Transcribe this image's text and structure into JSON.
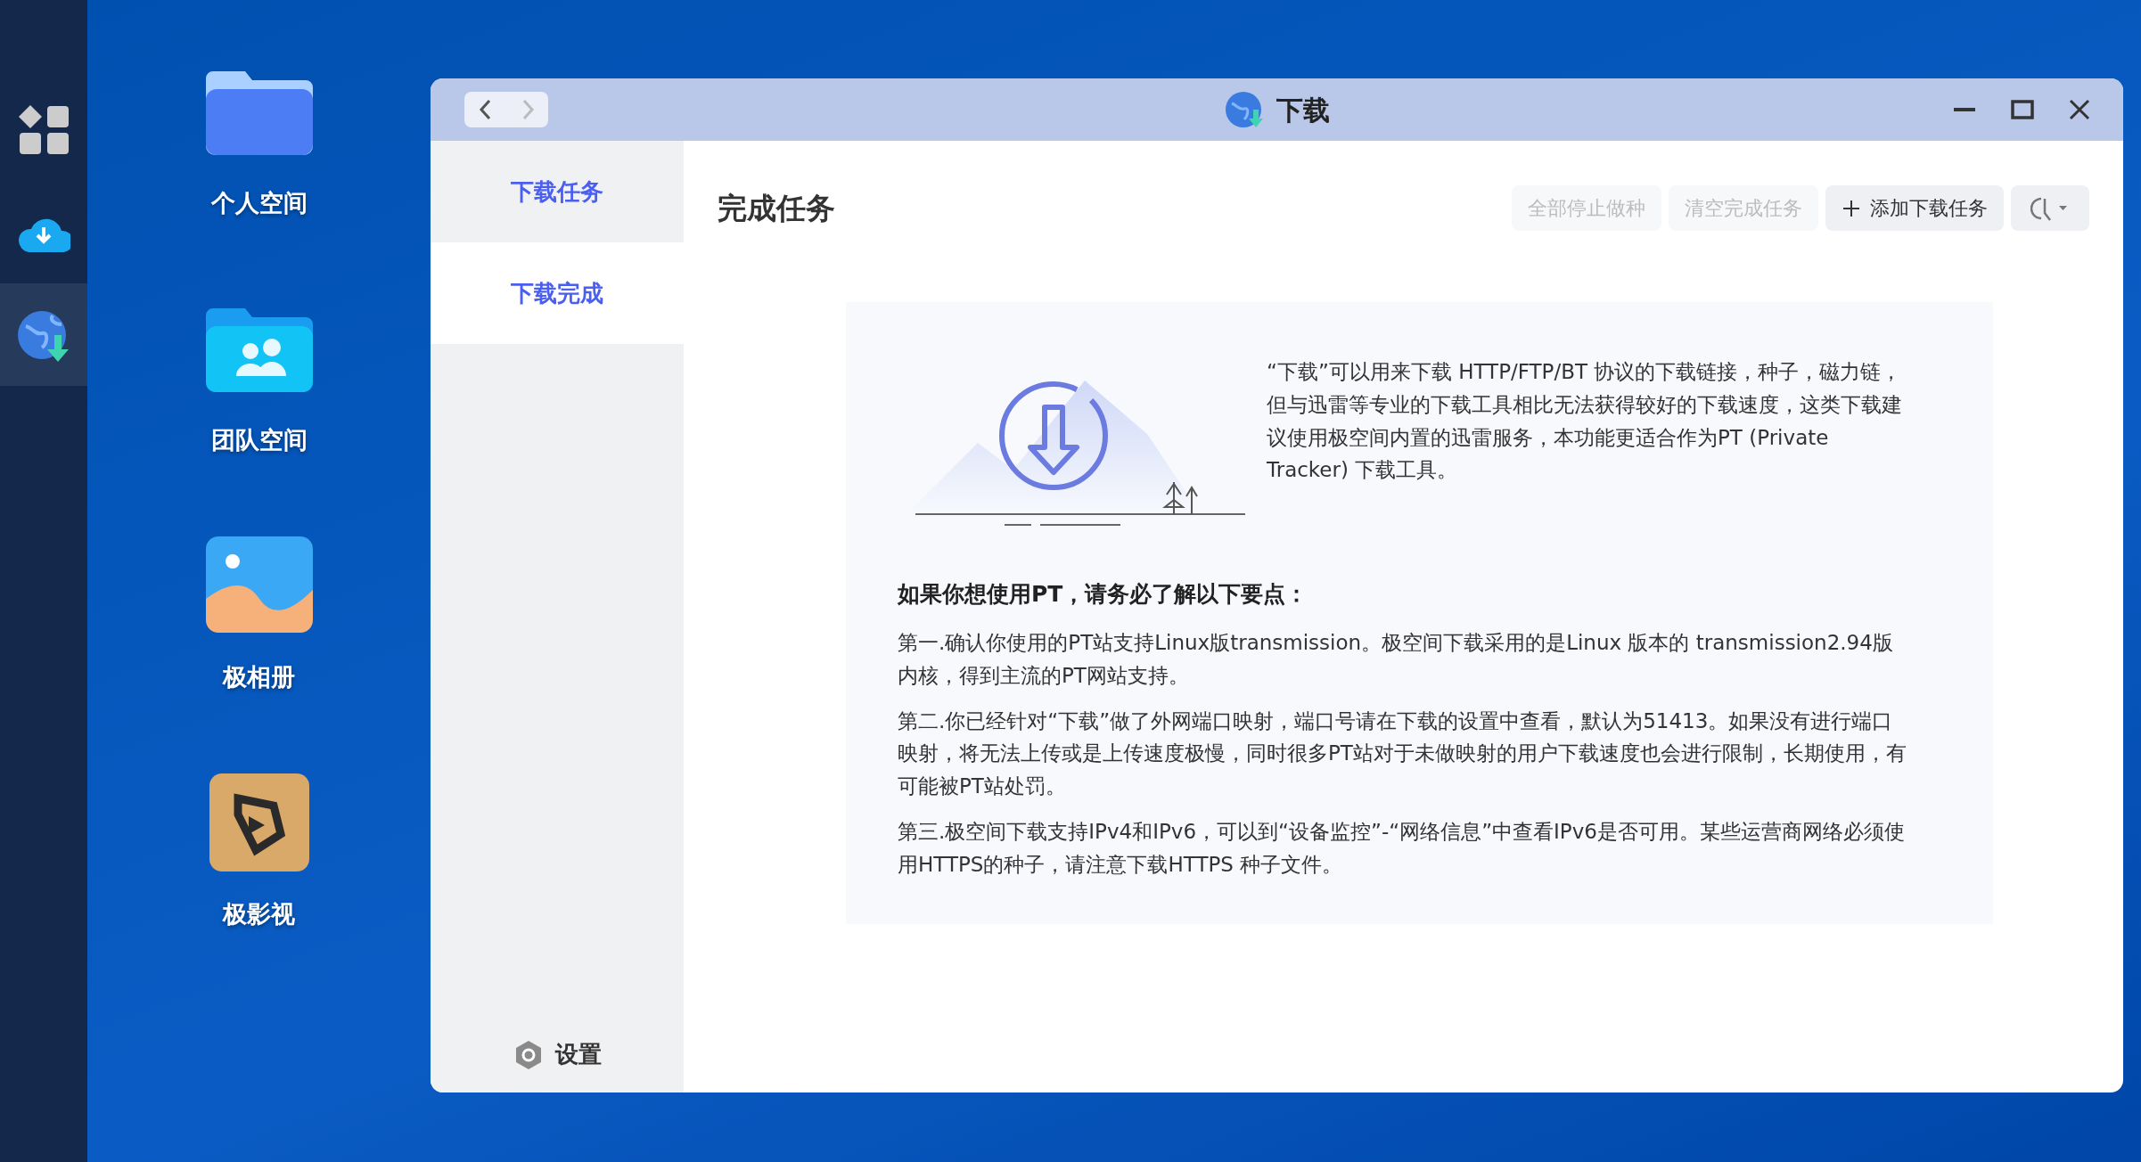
{
  "dock": {
    "items": [
      {
        "kind": "apps",
        "selected": false
      },
      {
        "kind": "cloud",
        "selected": false
      },
      {
        "kind": "globe",
        "selected": true
      }
    ]
  },
  "desktop_icons": [
    {
      "kind": "folder",
      "label": "个人空间"
    },
    {
      "kind": "team",
      "label": "团队空间"
    },
    {
      "kind": "photos",
      "label": "极相册"
    },
    {
      "kind": "video",
      "label": "极影视"
    }
  ],
  "window": {
    "title": "下载",
    "back": {
      "disabled": false
    },
    "forward": {
      "disabled": true
    }
  },
  "sidebar": {
    "items": [
      {
        "label": "下载任务",
        "selected": false
      },
      {
        "label": "下载完成",
        "selected": true
      }
    ],
    "settings": "设置"
  },
  "content": {
    "heading": "完成任务",
    "buttons": [
      {
        "kind": "plain",
        "label": "全部停止做种",
        "disabled": true
      },
      {
        "kind": "plain",
        "label": "清空完成任务",
        "disabled": true
      },
      {
        "kind": "add",
        "label": "添加下载任务",
        "disabled": false
      },
      {
        "kind": "sort",
        "disabled": false
      }
    ],
    "intro": "“下载”可以用来下载 HTTP/FTP/BT 协议的下载链接，种子，磁力链，但与迅雷等专业的下载工具相比无法获得较好的下载速度，这类下载建议使用极空间内置的迅雷服务，本功能更适合作为PT (Private Tracker) 下载工具。",
    "tips_heading": "如果你想使用PT，请务必了解以下要点：",
    "tips": [
      "第一.确认你使用的PT站支持Linux版transmission。极空间下载采用的是Linux 版本的 transmission2.94版内核，得到主流的PT网站支持。",
      "第二.你已经针对“下载”做了外网端口映射，端口号请在下载的设置中查看，默认为51413。如果没有进行端口映射，将无法上传或是上传速度极慢，同时很多PT站对于未做映射的用户下载速度也会进行限制，长期使用，有可能被PT站处罚。",
      "第三.极空间下载支持IPv4和IPv6，可以到“设备监控”-“网络信息”中查看IPv6是否可用。某些运营商网络必须使用HTTPS的种子，请注意下载HTTPS 种子文件。"
    ]
  }
}
